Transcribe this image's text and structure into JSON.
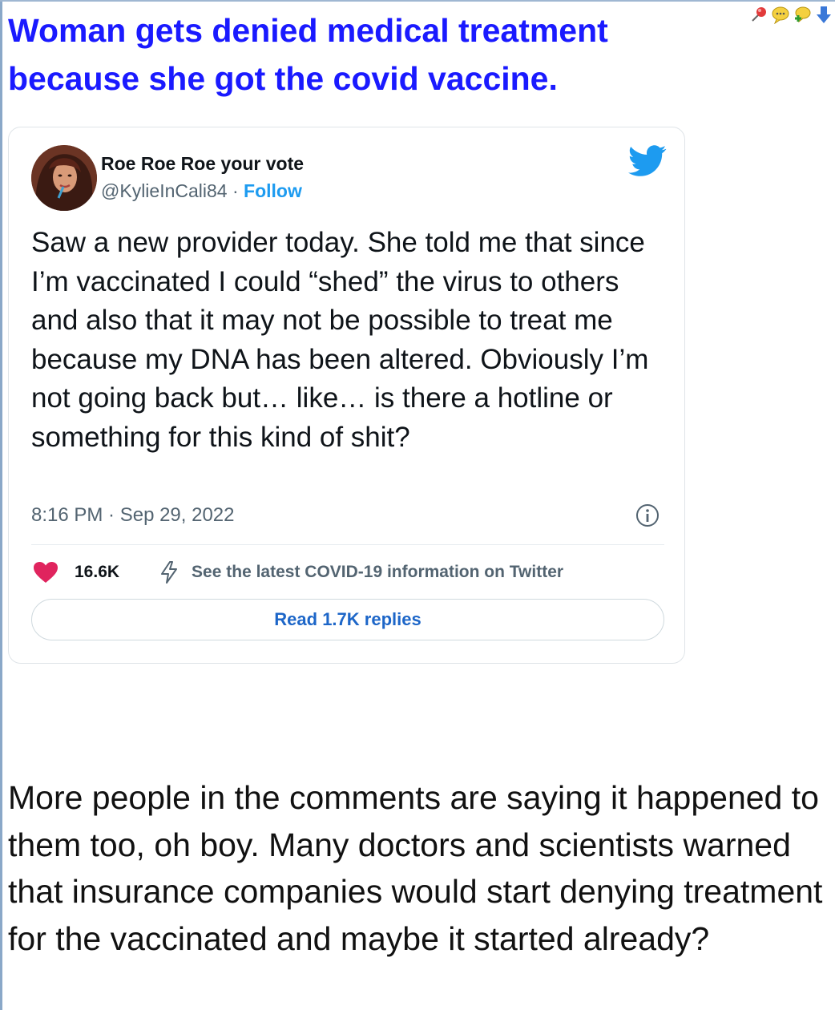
{
  "post": {
    "title": "Woman gets denied medical treatment because she got the covid vaccine.",
    "body": "More people in the comments are saying it happened to them too, oh boy. Many doctors and scientists warned that insurance companies would start denying treatment for the vaccinated and maybe it started already?",
    "tool_icons": [
      "pin-icon",
      "quote-icon",
      "reply-icon",
      "down-arrow-icon"
    ],
    "title_color": "#1a1aff"
  },
  "tweet": {
    "author_name": "Roe Roe Roe your vote",
    "handle": "@KylieInCali84",
    "separator": " · ",
    "follow_label": "Follow",
    "text": "Saw a new provider today. She told me that since I’m vaccinated I could “shed” the virus to others and also that it may not be possible to treat me because my DNA has been altered. Obviously I’m not going back but… like… is there a hotline or something for this kind of shit?",
    "timestamp": "8:16 PM · Sep 29, 2022",
    "likes": "16.6K",
    "covid_info_label": "See the latest COVID-19 information on Twitter",
    "read_replies_label": "Read 1.7K replies",
    "icons": [
      "avatar",
      "twitter-bird-icon",
      "info-icon",
      "heart-icon",
      "bolt-icon"
    ],
    "colors": {
      "twitter_blue": "#1d9bf0",
      "heart_red": "#e0245e",
      "muted_text": "#536471"
    }
  }
}
